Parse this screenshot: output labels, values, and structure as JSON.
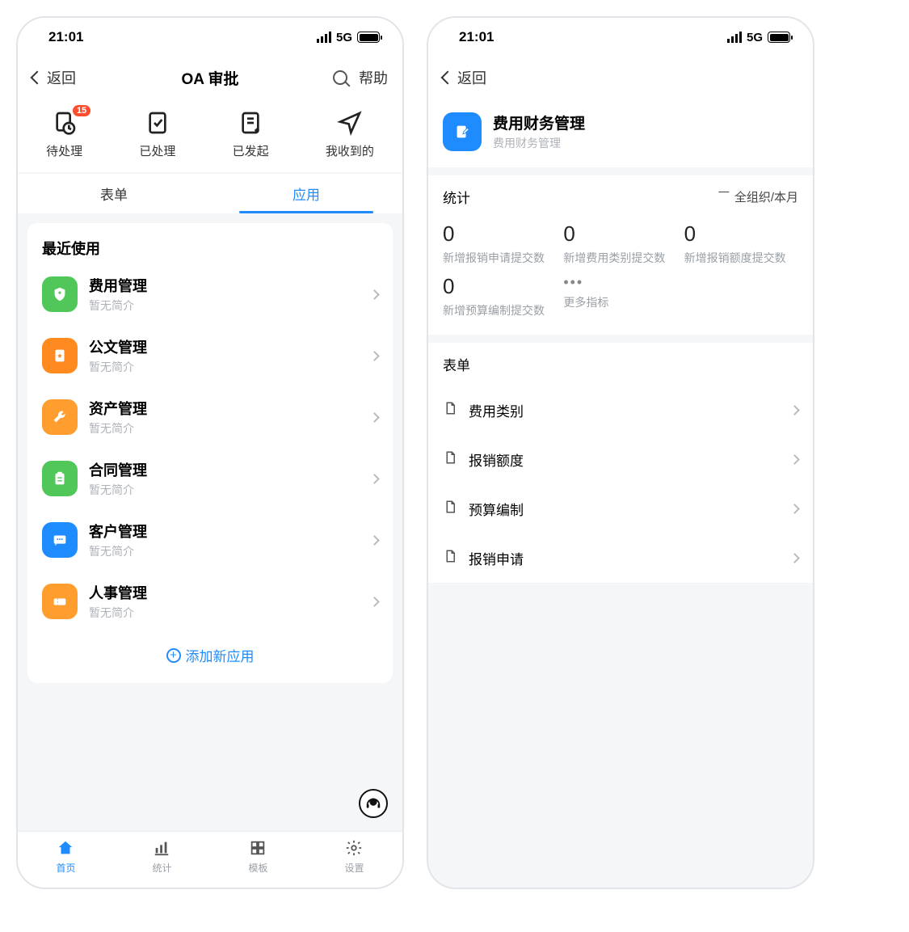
{
  "status": {
    "time": "21:01",
    "network": "5G"
  },
  "left": {
    "nav": {
      "back": "返回",
      "title": "OA 审批",
      "help": "帮助"
    },
    "actions": {
      "pending": {
        "label": "待处理",
        "badge": "15"
      },
      "done": {
        "label": "已处理"
      },
      "sent": {
        "label": "已发起"
      },
      "received": {
        "label": "我收到的"
      }
    },
    "tabs": {
      "form": "表单",
      "app": "应用"
    },
    "recent_title": "最近使用",
    "apps": [
      {
        "title": "费用管理",
        "sub": "暂无简介",
        "bg": "greenbg",
        "icon": "shield"
      },
      {
        "title": "公文管理",
        "sub": "暂无简介",
        "bg": "orangebg",
        "icon": "starfile"
      },
      {
        "title": "资产管理",
        "sub": "暂无简介",
        "bg": "orangebg2",
        "icon": "wrench"
      },
      {
        "title": "合同管理",
        "sub": "暂无简介",
        "bg": "greenbg",
        "icon": "clip"
      },
      {
        "title": "客户管理",
        "sub": "暂无简介",
        "bg": "bluebg",
        "icon": "chat"
      },
      {
        "title": "人事管理",
        "sub": "暂无简介",
        "bg": "orangebg2",
        "icon": "ticket"
      }
    ],
    "add_app": "添加新应用",
    "tabbar": {
      "home": "首页",
      "stats": "统计",
      "template": "模板",
      "settings": "设置"
    }
  },
  "right": {
    "nav": {
      "back": "返回"
    },
    "header": {
      "title": "费用财务管理",
      "sub": "费用财务管理"
    },
    "stats": {
      "title": "统计",
      "filter": "全组织/本月",
      "cells": [
        {
          "val": "0",
          "label": "新增报销申请提交数"
        },
        {
          "val": "0",
          "label": "新增费用类别提交数"
        },
        {
          "val": "0",
          "label": "新增报销额度提交数"
        },
        {
          "val": "0",
          "label": "新增预算编制提交数"
        }
      ],
      "more": "更多指标"
    },
    "forms": {
      "title": "表单",
      "items": [
        {
          "title": "费用类别"
        },
        {
          "title": "报销额度"
        },
        {
          "title": "预算编制"
        },
        {
          "title": "报销申请"
        }
      ]
    }
  }
}
